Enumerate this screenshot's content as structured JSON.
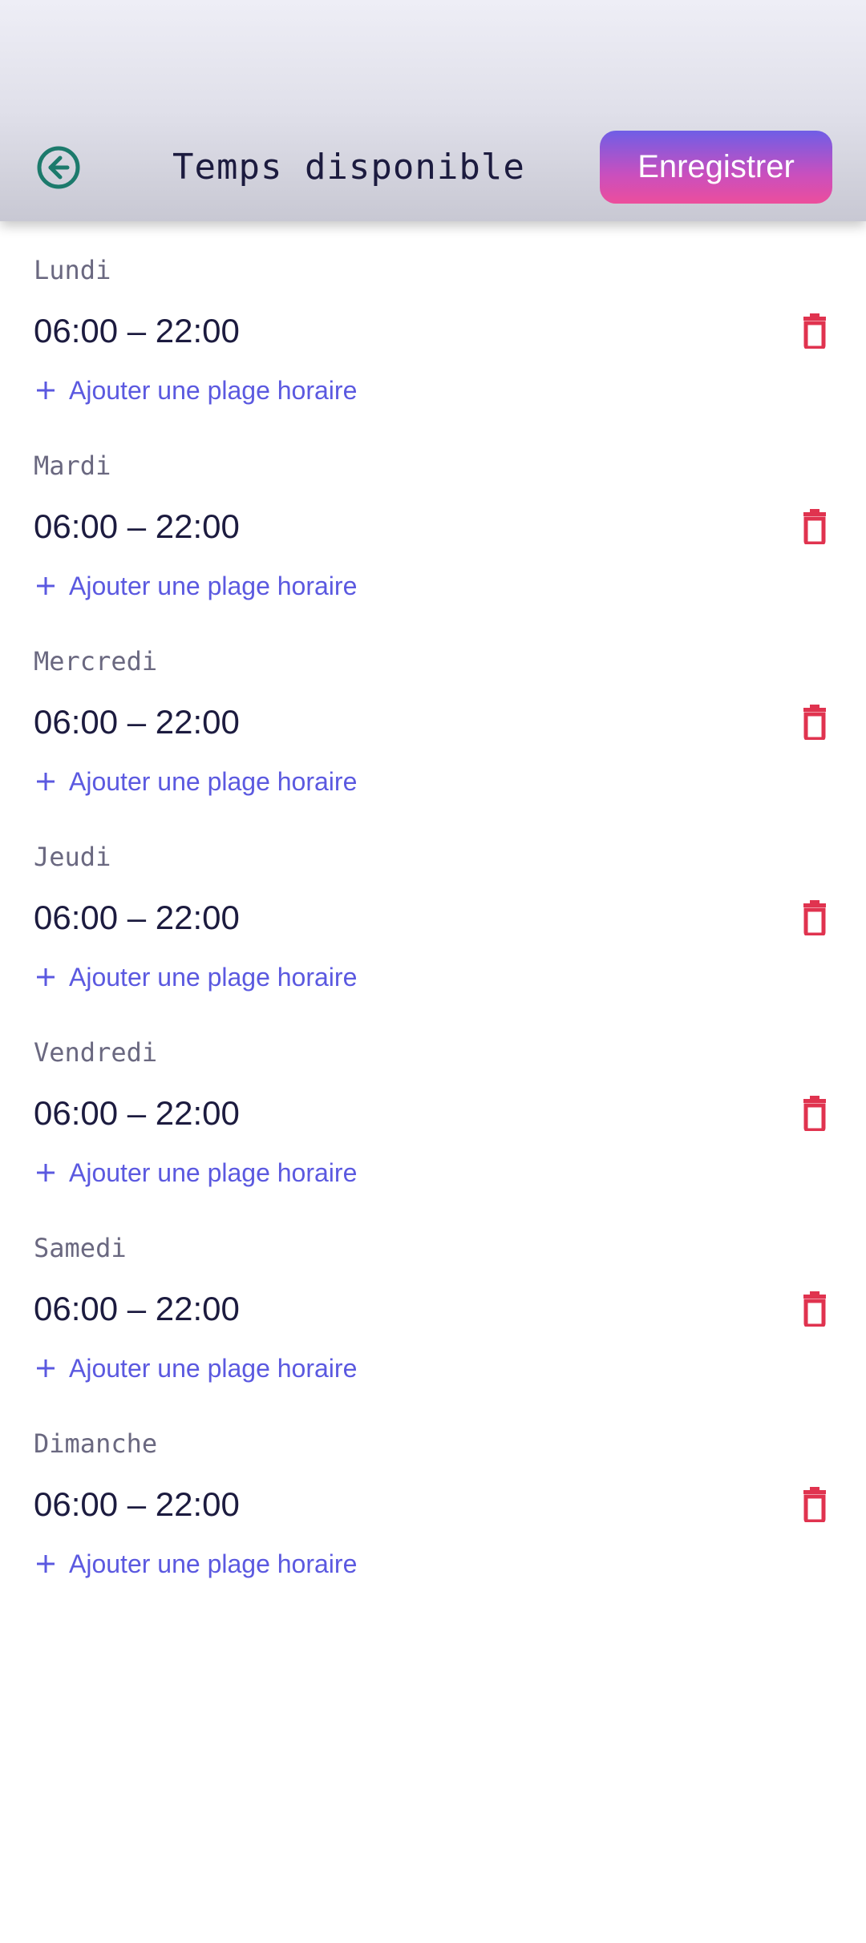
{
  "header": {
    "title": "Temps disponible",
    "save_label": "Enregistrer",
    "back_icon": "arrow-left-circle-icon"
  },
  "colors": {
    "accent": "#5b59e0",
    "delete": "#e0334f",
    "back_icon": "#1c7a6c",
    "title": "#1c1b3f",
    "day_label": "#6a6880"
  },
  "days": [
    {
      "name": "Lundi",
      "slots": [
        {
          "range": "06:00 – 22:00"
        }
      ],
      "add_label": "Ajouter une plage horaire"
    },
    {
      "name": "Mardi",
      "slots": [
        {
          "range": "06:00 – 22:00"
        }
      ],
      "add_label": "Ajouter une plage horaire"
    },
    {
      "name": "Mercredi",
      "slots": [
        {
          "range": "06:00 – 22:00"
        }
      ],
      "add_label": "Ajouter une plage horaire"
    },
    {
      "name": "Jeudi",
      "slots": [
        {
          "range": "06:00 – 22:00"
        }
      ],
      "add_label": "Ajouter une plage horaire"
    },
    {
      "name": "Vendredi",
      "slots": [
        {
          "range": "06:00 – 22:00"
        }
      ],
      "add_label": "Ajouter une plage horaire"
    },
    {
      "name": "Samedi",
      "slots": [
        {
          "range": "06:00 – 22:00"
        }
      ],
      "add_label": "Ajouter une plage horaire"
    },
    {
      "name": "Dimanche",
      "slots": [
        {
          "range": "06:00 – 22:00"
        }
      ],
      "add_label": "Ajouter une plage horaire"
    }
  ]
}
